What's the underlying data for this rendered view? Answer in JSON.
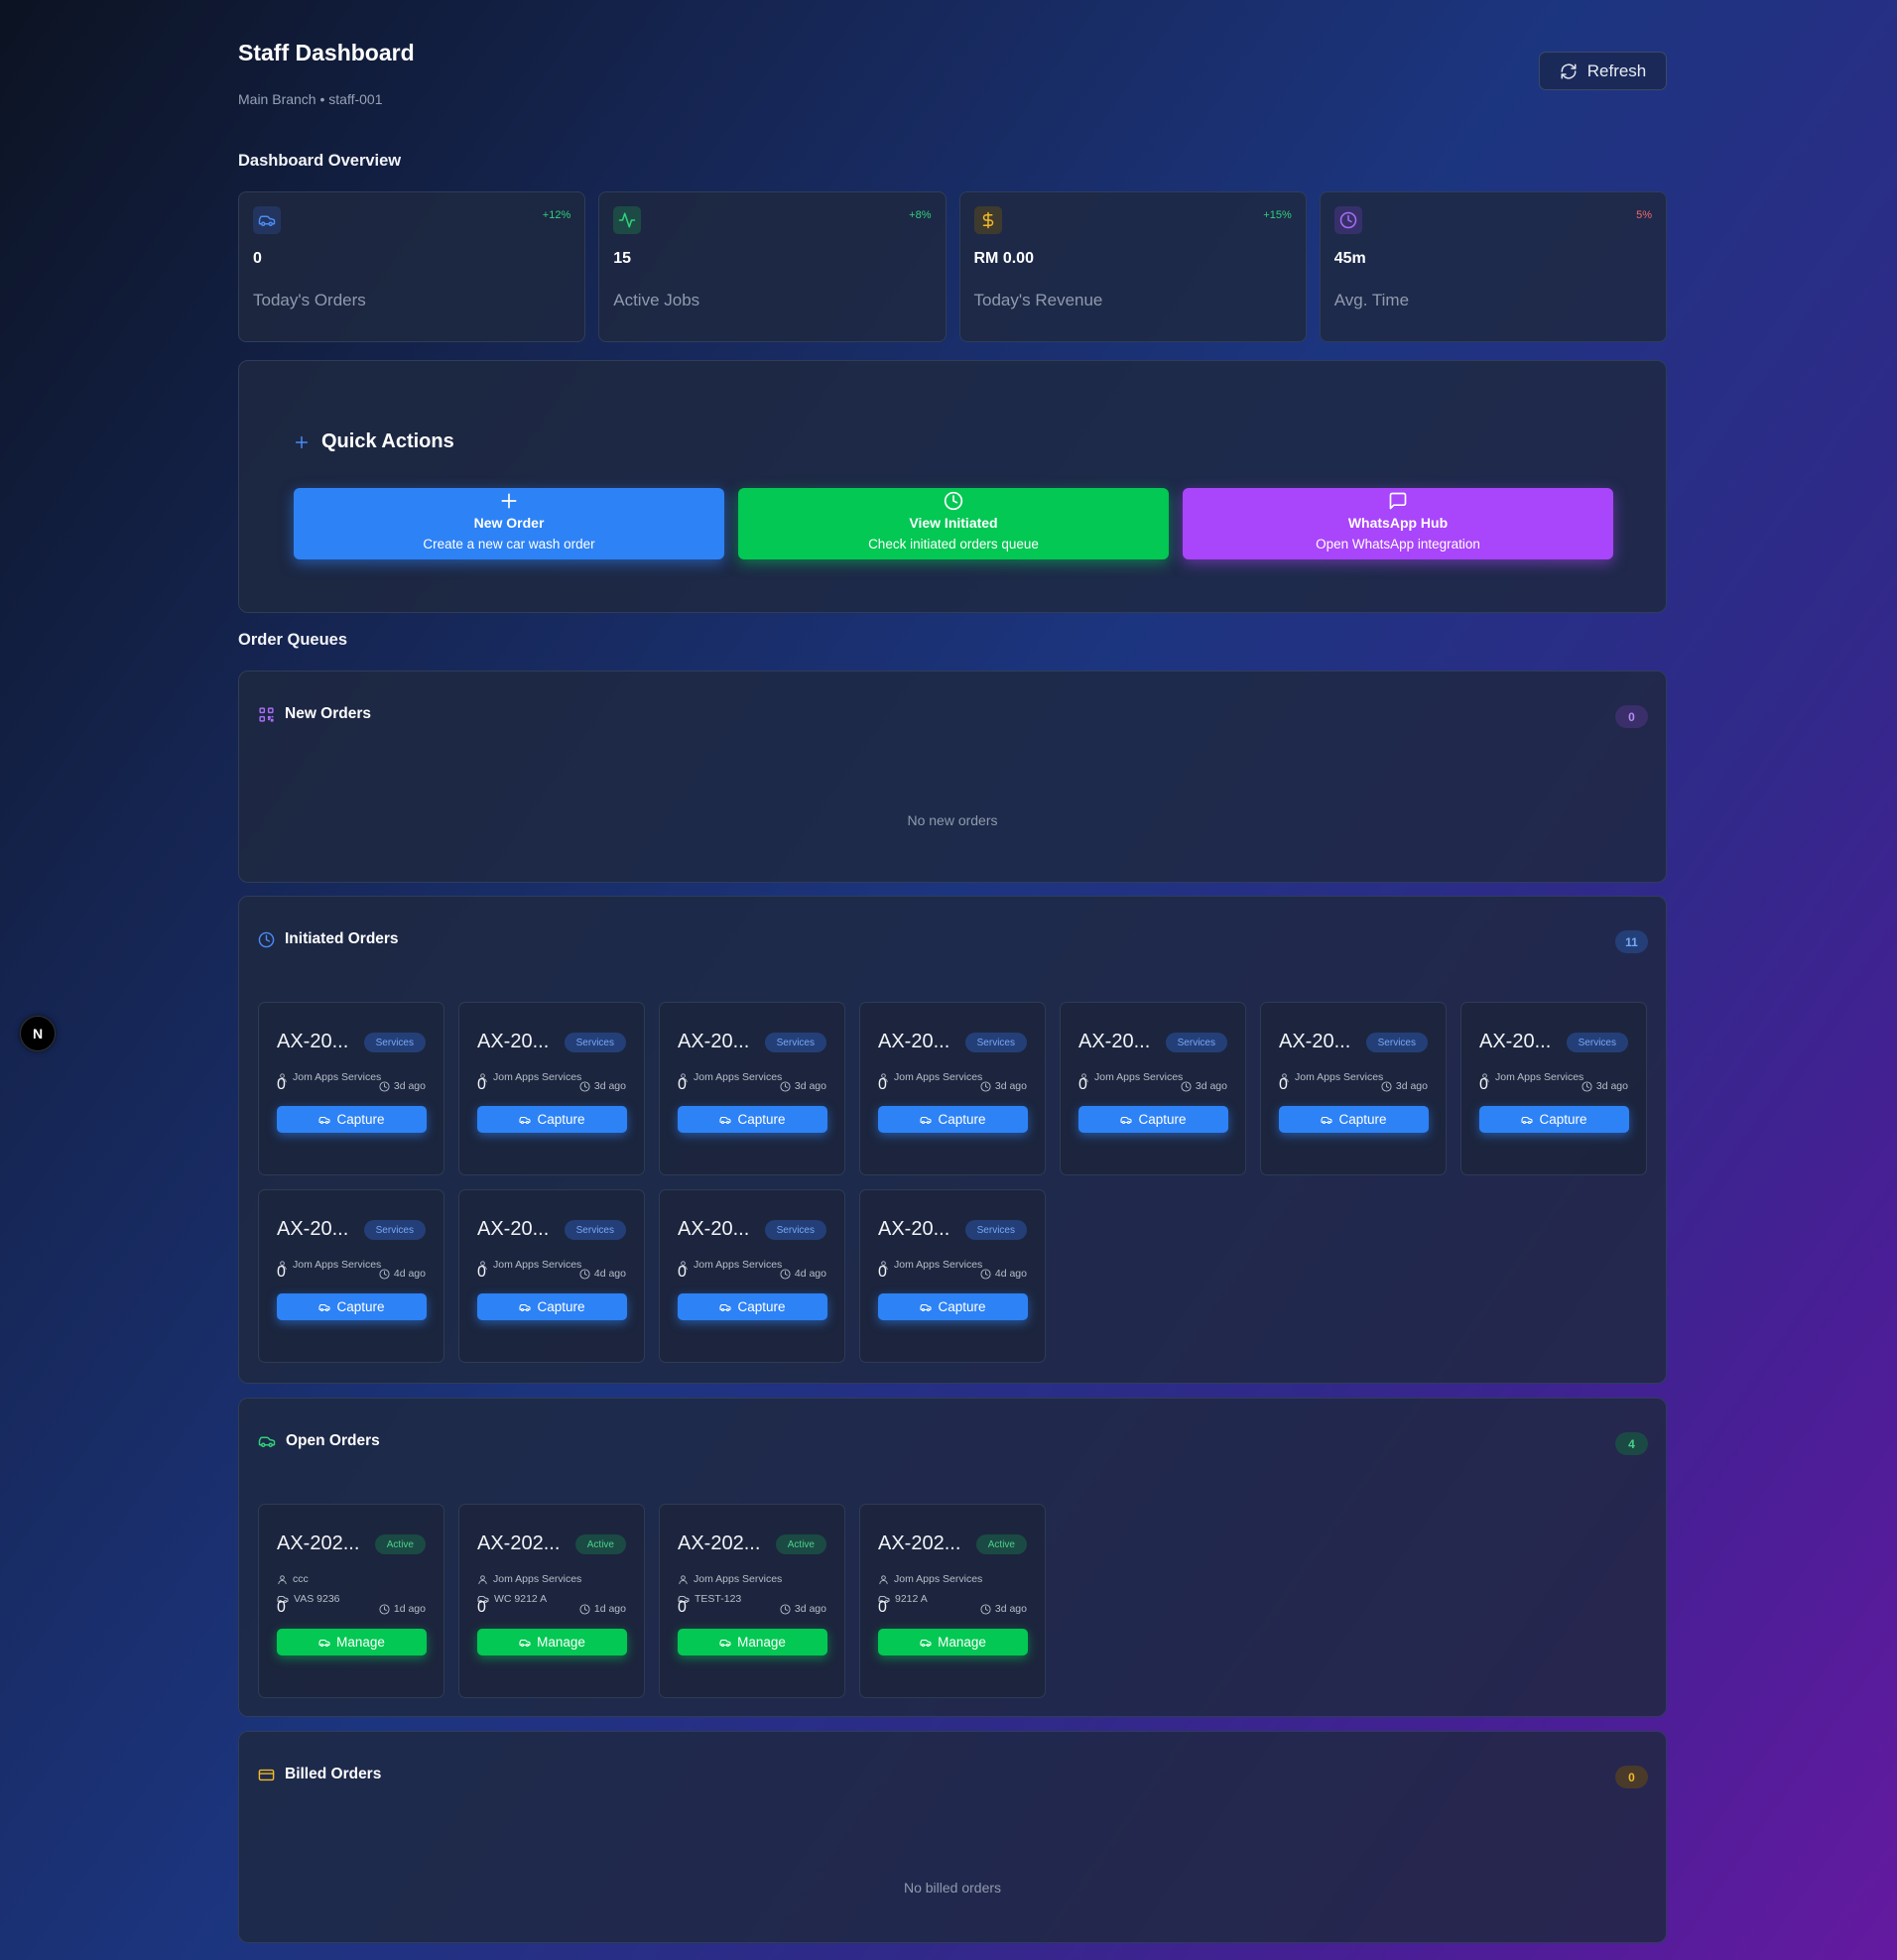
{
  "header": {
    "title": "Staff Dashboard",
    "subtitle": "Main Branch • staff-001",
    "refresh_label": "Refresh"
  },
  "overview": {
    "title": "Dashboard Overview",
    "stats": [
      {
        "icon": "car-icon",
        "change": "+12%",
        "value": "0",
        "label": "Today's Orders",
        "accent": "#4a8cf7",
        "change_color": "#2fd27a"
      },
      {
        "icon": "activity-icon",
        "change": "+8%",
        "value": "15",
        "label": "Active Jobs",
        "accent": "#2fd27a",
        "change_color": "#2fd27a"
      },
      {
        "icon": "dollar-icon",
        "change": "+15%",
        "value": "RM 0.00",
        "label": "Today's Revenue",
        "accent": "#f2b928",
        "change_color": "#2fd27a"
      },
      {
        "icon": "clock-icon",
        "change": "5%",
        "value": "45m",
        "label": "Avg. Time",
        "accent": "#a86ef5",
        "change_color": "#f06a6a"
      }
    ]
  },
  "quick_actions": {
    "title": "Quick Actions",
    "buttons": [
      {
        "icon": "plus-icon",
        "title": "New Order",
        "subtitle": "Create a new car wash order"
      },
      {
        "icon": "clock-icon",
        "title": "View Initiated",
        "subtitle": "Check initiated orders queue"
      },
      {
        "icon": "message-icon",
        "title": "WhatsApp Hub",
        "subtitle": "Open WhatsApp integration"
      }
    ]
  },
  "queues": {
    "title": "Order Queues",
    "new_orders": {
      "title": "New Orders",
      "count": "0",
      "empty": "No new orders"
    },
    "initiated": {
      "title": "Initiated Orders",
      "count": "11",
      "orders": [
        {
          "id": "AX-20...",
          "badge": "Services",
          "customer": "Jom Apps Services",
          "amount": "0",
          "time": "3d ago",
          "action": "Capture"
        },
        {
          "id": "AX-20...",
          "badge": "Services",
          "customer": "Jom Apps Services",
          "amount": "0",
          "time": "3d ago",
          "action": "Capture"
        },
        {
          "id": "AX-20...",
          "badge": "Services",
          "customer": "Jom Apps Services",
          "amount": "0",
          "time": "3d ago",
          "action": "Capture"
        },
        {
          "id": "AX-20...",
          "badge": "Services",
          "customer": "Jom Apps Services",
          "amount": "0",
          "time": "3d ago",
          "action": "Capture"
        },
        {
          "id": "AX-20...",
          "badge": "Services",
          "customer": "Jom Apps Services",
          "amount": "0",
          "time": "3d ago",
          "action": "Capture"
        },
        {
          "id": "AX-20...",
          "badge": "Services",
          "customer": "Jom Apps Services",
          "amount": "0",
          "time": "3d ago",
          "action": "Capture"
        },
        {
          "id": "AX-20...",
          "badge": "Services",
          "customer": "Jom Apps Services",
          "amount": "0",
          "time": "3d ago",
          "action": "Capture"
        },
        {
          "id": "AX-20...",
          "badge": "Services",
          "customer": "Jom Apps Services",
          "amount": "0",
          "time": "4d ago",
          "action": "Capture"
        },
        {
          "id": "AX-20...",
          "badge": "Services",
          "customer": "Jom Apps Services",
          "amount": "0",
          "time": "4d ago",
          "action": "Capture"
        },
        {
          "id": "AX-20...",
          "badge": "Services",
          "customer": "Jom Apps Services",
          "amount": "0",
          "time": "4d ago",
          "action": "Capture"
        },
        {
          "id": "AX-20...",
          "badge": "Services",
          "customer": "Jom Apps Services",
          "amount": "0",
          "time": "4d ago",
          "action": "Capture"
        }
      ]
    },
    "open": {
      "title": "Open Orders",
      "count": "4",
      "orders": [
        {
          "id": "AX-202...",
          "badge": "Active",
          "customer": "ccc",
          "plate": "VAS 9236",
          "amount": "0",
          "time": "1d ago",
          "action": "Manage"
        },
        {
          "id": "AX-202...",
          "badge": "Active",
          "customer": "Jom Apps Services",
          "plate": "WC 9212 A",
          "amount": "0",
          "time": "1d ago",
          "action": "Manage"
        },
        {
          "id": "AX-202...",
          "badge": "Active",
          "customer": "Jom Apps Services",
          "plate": "TEST-123",
          "amount": "0",
          "time": "3d ago",
          "action": "Manage"
        },
        {
          "id": "AX-202...",
          "badge": "Active",
          "customer": "Jom Apps Services",
          "plate": "9212 A",
          "amount": "0",
          "time": "3d ago",
          "action": "Manage"
        }
      ]
    },
    "billed": {
      "title": "Billed Orders",
      "count": "0",
      "empty": "No billed orders"
    }
  },
  "dev_badge": "N"
}
